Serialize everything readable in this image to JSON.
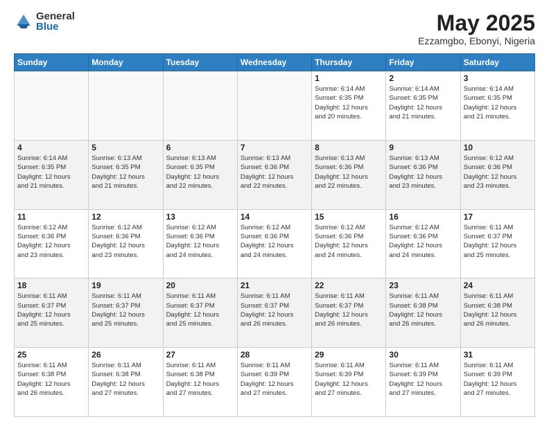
{
  "logo": {
    "general": "General",
    "blue": "Blue"
  },
  "header": {
    "title": "May 2025",
    "subtitle": "Ezzamgbo, Ebonyi, Nigeria"
  },
  "weekdays": [
    "Sunday",
    "Monday",
    "Tuesday",
    "Wednesday",
    "Thursday",
    "Friday",
    "Saturday"
  ],
  "weeks": [
    [
      {
        "day": "",
        "info": ""
      },
      {
        "day": "",
        "info": ""
      },
      {
        "day": "",
        "info": ""
      },
      {
        "day": "",
        "info": ""
      },
      {
        "day": "1",
        "info": "Sunrise: 6:14 AM\nSunset: 6:35 PM\nDaylight: 12 hours\nand 20 minutes."
      },
      {
        "day": "2",
        "info": "Sunrise: 6:14 AM\nSunset: 6:35 PM\nDaylight: 12 hours\nand 21 minutes."
      },
      {
        "day": "3",
        "info": "Sunrise: 6:14 AM\nSunset: 6:35 PM\nDaylight: 12 hours\nand 21 minutes."
      }
    ],
    [
      {
        "day": "4",
        "info": "Sunrise: 6:14 AM\nSunset: 6:35 PM\nDaylight: 12 hours\nand 21 minutes."
      },
      {
        "day": "5",
        "info": "Sunrise: 6:13 AM\nSunset: 6:35 PM\nDaylight: 12 hours\nand 21 minutes."
      },
      {
        "day": "6",
        "info": "Sunrise: 6:13 AM\nSunset: 6:35 PM\nDaylight: 12 hours\nand 22 minutes."
      },
      {
        "day": "7",
        "info": "Sunrise: 6:13 AM\nSunset: 6:36 PM\nDaylight: 12 hours\nand 22 minutes."
      },
      {
        "day": "8",
        "info": "Sunrise: 6:13 AM\nSunset: 6:36 PM\nDaylight: 12 hours\nand 22 minutes."
      },
      {
        "day": "9",
        "info": "Sunrise: 6:13 AM\nSunset: 6:36 PM\nDaylight: 12 hours\nand 23 minutes."
      },
      {
        "day": "10",
        "info": "Sunrise: 6:12 AM\nSunset: 6:36 PM\nDaylight: 12 hours\nand 23 minutes."
      }
    ],
    [
      {
        "day": "11",
        "info": "Sunrise: 6:12 AM\nSunset: 6:36 PM\nDaylight: 12 hours\nand 23 minutes."
      },
      {
        "day": "12",
        "info": "Sunrise: 6:12 AM\nSunset: 6:36 PM\nDaylight: 12 hours\nand 23 minutes."
      },
      {
        "day": "13",
        "info": "Sunrise: 6:12 AM\nSunset: 6:36 PM\nDaylight: 12 hours\nand 24 minutes."
      },
      {
        "day": "14",
        "info": "Sunrise: 6:12 AM\nSunset: 6:36 PM\nDaylight: 12 hours\nand 24 minutes."
      },
      {
        "day": "15",
        "info": "Sunrise: 6:12 AM\nSunset: 6:36 PM\nDaylight: 12 hours\nand 24 minutes."
      },
      {
        "day": "16",
        "info": "Sunrise: 6:12 AM\nSunset: 6:36 PM\nDaylight: 12 hours\nand 24 minutes."
      },
      {
        "day": "17",
        "info": "Sunrise: 6:11 AM\nSunset: 6:37 PM\nDaylight: 12 hours\nand 25 minutes."
      }
    ],
    [
      {
        "day": "18",
        "info": "Sunrise: 6:11 AM\nSunset: 6:37 PM\nDaylight: 12 hours\nand 25 minutes."
      },
      {
        "day": "19",
        "info": "Sunrise: 6:11 AM\nSunset: 6:37 PM\nDaylight: 12 hours\nand 25 minutes."
      },
      {
        "day": "20",
        "info": "Sunrise: 6:11 AM\nSunset: 6:37 PM\nDaylight: 12 hours\nand 25 minutes."
      },
      {
        "day": "21",
        "info": "Sunrise: 6:11 AM\nSunset: 6:37 PM\nDaylight: 12 hours\nand 26 minutes."
      },
      {
        "day": "22",
        "info": "Sunrise: 6:11 AM\nSunset: 6:37 PM\nDaylight: 12 hours\nand 26 minutes."
      },
      {
        "day": "23",
        "info": "Sunrise: 6:11 AM\nSunset: 6:38 PM\nDaylight: 12 hours\nand 26 minutes."
      },
      {
        "day": "24",
        "info": "Sunrise: 6:11 AM\nSunset: 6:38 PM\nDaylight: 12 hours\nand 26 minutes."
      }
    ],
    [
      {
        "day": "25",
        "info": "Sunrise: 6:11 AM\nSunset: 6:38 PM\nDaylight: 12 hours\nand 26 minutes."
      },
      {
        "day": "26",
        "info": "Sunrise: 6:11 AM\nSunset: 6:38 PM\nDaylight: 12 hours\nand 27 minutes."
      },
      {
        "day": "27",
        "info": "Sunrise: 6:11 AM\nSunset: 6:38 PM\nDaylight: 12 hours\nand 27 minutes."
      },
      {
        "day": "28",
        "info": "Sunrise: 6:11 AM\nSunset: 6:39 PM\nDaylight: 12 hours\nand 27 minutes."
      },
      {
        "day": "29",
        "info": "Sunrise: 6:11 AM\nSunset: 6:39 PM\nDaylight: 12 hours\nand 27 minutes."
      },
      {
        "day": "30",
        "info": "Sunrise: 6:11 AM\nSunset: 6:39 PM\nDaylight: 12 hours\nand 27 minutes."
      },
      {
        "day": "31",
        "info": "Sunrise: 6:11 AM\nSunset: 6:39 PM\nDaylight: 12 hours\nand 27 minutes."
      }
    ]
  ]
}
